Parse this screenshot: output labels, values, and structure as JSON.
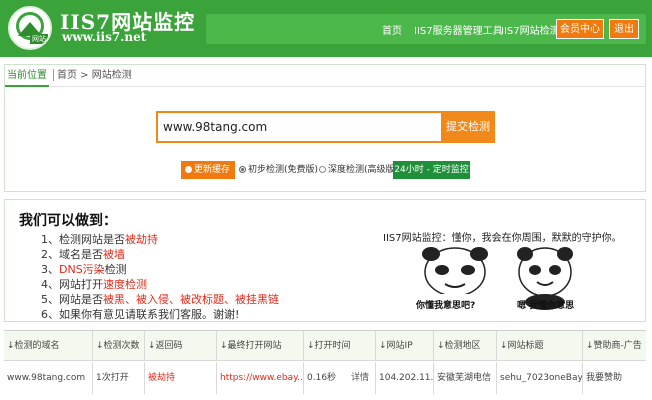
{
  "header": {
    "logo_tag": "网站",
    "site_title": "IIS7网站监控",
    "site_url": "www.iis7.net",
    "nav": [
      {
        "label": "首页"
      },
      {
        "label": "IIS7服务器管理工具"
      },
      {
        "label": "IIS7网站检测"
      }
    ],
    "member_button": "会员中心",
    "logout_button": "退出"
  },
  "breadcrumb": {
    "current_label": "当前位置",
    "path": "首页 > 网站检测"
  },
  "search": {
    "value": "www.98tang.com",
    "submit_label": "提交检测"
  },
  "options": {
    "refresh_cache": "更新缓存",
    "basic_check": "初步检测(免费版)",
    "deep_check": "深度检测(高级版)",
    "monitor_24h": "24小时 - 定时监控"
  },
  "info": {
    "title": "我们可以做到：",
    "items": [
      {
        "prefix": "1、检测网站是否",
        "highlight": "被劫持",
        "suffix": ""
      },
      {
        "prefix": "2、域名是否",
        "highlight": "被墙",
        "suffix": ""
      },
      {
        "prefix": "3、",
        "highlight": "DNS污染",
        "suffix": "检测"
      },
      {
        "prefix": "4、网站打开",
        "highlight": "速度检测",
        "suffix": ""
      },
      {
        "prefix": "5、网站是否",
        "highlight": "被黑、被入侵、被改标题、被挂黑链",
        "suffix": ""
      },
      {
        "prefix": "6、如果你有意见请联系我们客服。谢谢!",
        "highlight": "",
        "suffix": ""
      }
    ],
    "caption": "IIS7网站监控：懂你，我会在你周围，默默的守护你。",
    "meme_left_caption": "你懂我意思吧?",
    "meme_right_caption": "嗯 我懂你意思"
  },
  "table": {
    "headers": [
      "↓检测的域名",
      "↓检测次数",
      "↓返回码",
      "↓最终打开网站",
      "↓打开时间",
      "↓网站IP",
      "↓检测地区",
      "↓网站标题",
      "↓赞助商-广告"
    ],
    "row": {
      "domain": "www.98tang.com",
      "count": "1次打开",
      "code": "被劫持",
      "final_url": "https://www.ebay....",
      "open_time": "0.16秒",
      "detail": "详情",
      "ip": "104.202.11...",
      "region": "安徽芜湖电信",
      "title": "sehu_7023oneBay",
      "sponsor": "我要赞助"
    }
  },
  "colors": {
    "brand_green": "#3aa33a",
    "accent_orange": "#f0891a",
    "alert_red": "#e02a1a"
  }
}
